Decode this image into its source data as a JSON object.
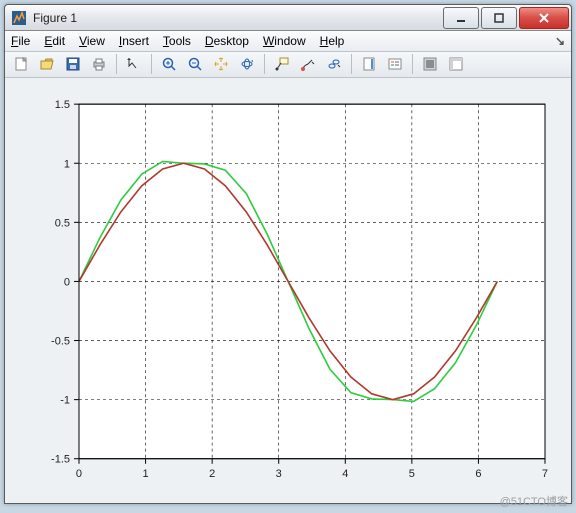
{
  "window": {
    "title": "Figure 1"
  },
  "menu": {
    "file": {
      "pre": "",
      "u": "F",
      "post": "ile"
    },
    "edit": {
      "pre": "",
      "u": "E",
      "post": "dit"
    },
    "view": {
      "pre": "",
      "u": "V",
      "post": "iew"
    },
    "insert": {
      "pre": "",
      "u": "I",
      "post": "nsert"
    },
    "tools": {
      "pre": "",
      "u": "T",
      "post": "ools"
    },
    "desktop": {
      "pre": "",
      "u": "D",
      "post": "esktop"
    },
    "windowm": {
      "pre": "",
      "u": "W",
      "post": "indow"
    },
    "help": {
      "pre": "",
      "u": "H",
      "post": "elp"
    },
    "tail": "↘"
  },
  "watermark": "@51CTO博客",
  "chart_data": {
    "type": "line",
    "xlim": [
      0,
      7
    ],
    "ylim": [
      -1.5,
      1.5
    ],
    "xticks": [
      0,
      1,
      2,
      3,
      4,
      5,
      6,
      7
    ],
    "yticks": [
      -1.5,
      -1,
      -0.5,
      0,
      0.5,
      1,
      1.5
    ],
    "xticklabels": [
      "0",
      "1",
      "2",
      "3",
      "4",
      "5",
      "6",
      "7"
    ],
    "yticklabels": [
      "-1.5",
      "-1",
      "-0.5",
      "0",
      "0.5",
      "1",
      "1.5"
    ],
    "grid": "dashed",
    "series": [
      {
        "name": "green-curve",
        "color": "#2ecc40",
        "x": [
          0,
          0.3142,
          0.6283,
          0.9425,
          1.2566,
          1.5708,
          1.885,
          2.1991,
          2.5133,
          2.8274,
          3.1416,
          3.4558,
          3.7699,
          4.0841,
          4.3982,
          4.7124,
          5.0265,
          5.3407,
          5.6549,
          5.969,
          6.2832
        ],
        "y": [
          0,
          0.37,
          0.688,
          0.908,
          1.015,
          1.0,
          0.994,
          0.941,
          0.743,
          0.399,
          0.0,
          -0.399,
          -0.743,
          -0.941,
          -0.994,
          -1.0,
          -1.015,
          -0.908,
          -0.688,
          -0.37,
          0.0
        ]
      },
      {
        "name": "red-curve",
        "color": "#b03a2e",
        "x": [
          0,
          0.3142,
          0.6283,
          0.9425,
          1.2566,
          1.5708,
          1.885,
          2.1991,
          2.5133,
          2.8274,
          3.1416,
          3.4558,
          3.7699,
          4.0841,
          4.3982,
          4.7124,
          5.0265,
          5.3407,
          5.6549,
          5.969,
          6.2832
        ],
        "y": [
          0,
          0.309,
          0.588,
          0.809,
          0.951,
          1.0,
          0.951,
          0.809,
          0.588,
          0.309,
          0.0,
          -0.309,
          -0.588,
          -0.809,
          -0.951,
          -1.0,
          -0.951,
          -0.809,
          -0.588,
          -0.309,
          0.0
        ]
      }
    ]
  }
}
